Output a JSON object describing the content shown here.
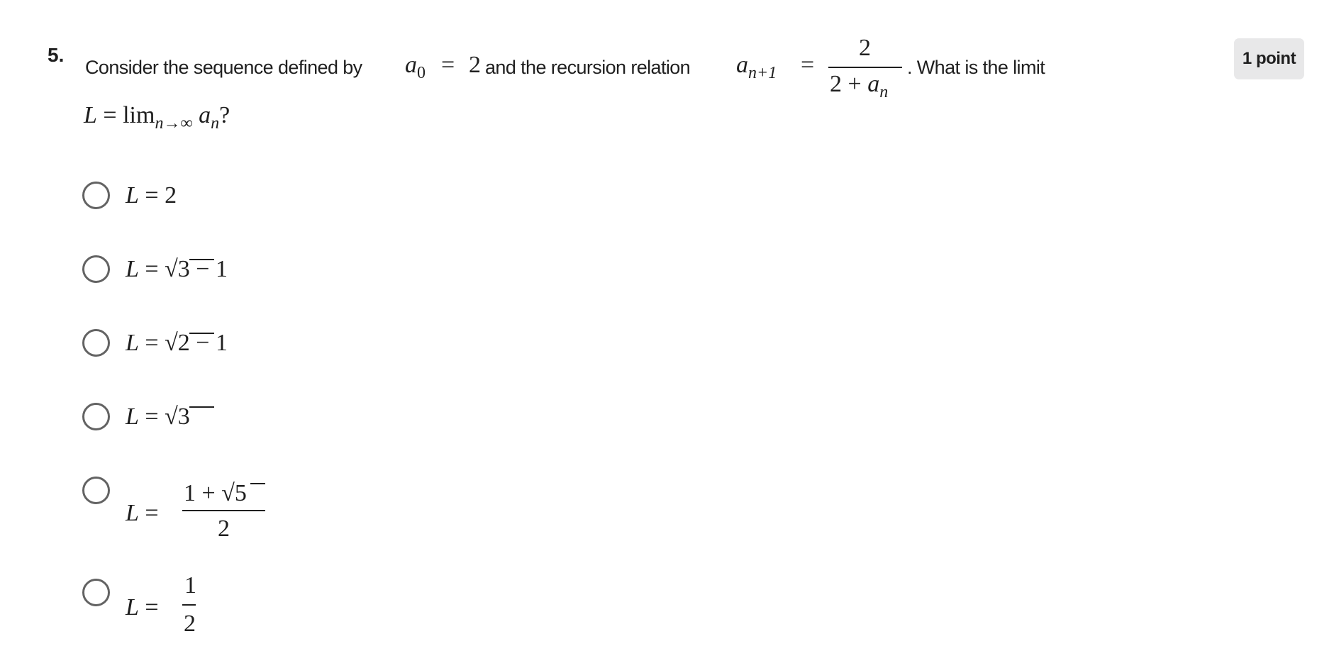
{
  "question": {
    "number": "5.",
    "points_badge": "1 point",
    "text_parts": {
      "p1": "Consider the sequence defined by",
      "a": "a",
      "zero": "0",
      "eq": "=",
      "two": "2",
      "p2": "and the recursion relation",
      "n_plus_1": "n+1",
      "frac_num": "2",
      "frac_den_two": "2",
      "plus": "+",
      "n": "n",
      "p3": ". What is the limit",
      "L": "L",
      "lim": "lim",
      "n_to_inf": "n→∞",
      "qmark": "?"
    },
    "full_text": "Consider the sequence defined by a_0 = 2 and the recursion relation a_{n+1} = 2/(2 + a_n). What is the limit L = lim_{n→∞} a_n?"
  },
  "options": [
    {
      "id": "opt-1",
      "label": "L = 2",
      "selected": false,
      "parts": {
        "L": "L",
        "eq": "=",
        "rhs": "2"
      }
    },
    {
      "id": "opt-2",
      "label": "L = √3 − 1",
      "selected": false,
      "parts": {
        "L": "L",
        "eq": "=",
        "rad": "√",
        "radicand": "3",
        "minus": "−",
        "one": "1"
      }
    },
    {
      "id": "opt-3",
      "label": "L = √2 − 1",
      "selected": false,
      "parts": {
        "L": "L",
        "eq": "=",
        "rad": "√",
        "radicand": "2",
        "minus": "−",
        "one": "1"
      }
    },
    {
      "id": "opt-4",
      "label": "L = √3",
      "selected": false,
      "parts": {
        "L": "L",
        "eq": "=",
        "rad": "√",
        "radicand": "3"
      }
    },
    {
      "id": "opt-5",
      "label": "L = (1 + √5)/2",
      "selected": false,
      "parts": {
        "L": "L",
        "eq": "=",
        "num_one": "1",
        "plus": "+",
        "rad": "√",
        "radicand": "5",
        "den": "2"
      }
    },
    {
      "id": "opt-6",
      "label": "L = 1/2",
      "selected": false,
      "parts": {
        "L": "L",
        "eq": "=",
        "num": "1",
        "den": "2"
      }
    }
  ],
  "colors": {
    "text": "#1f1f1f",
    "radio_border": "#636363",
    "badge_bg": "#e8e8e9",
    "background": "#ffffff"
  }
}
